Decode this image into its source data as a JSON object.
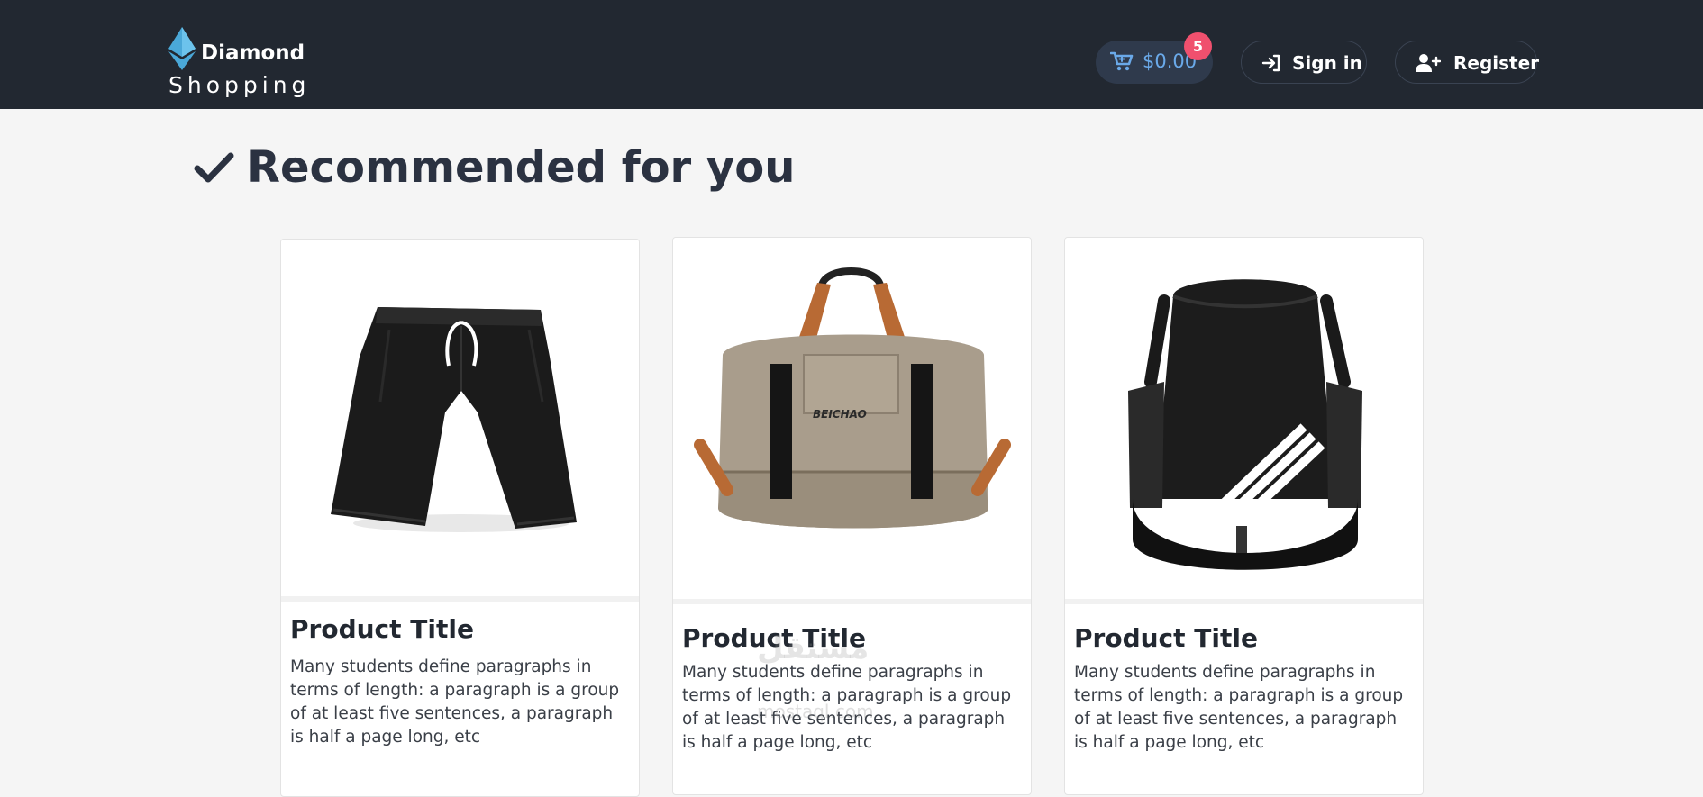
{
  "header": {
    "brand_line1": "Diamond",
    "brand_line2": "Shopping",
    "cart_amount": "$0.00",
    "cart_badge": "5",
    "signin_label": "Sign in",
    "register_label": "Register"
  },
  "section": {
    "title": "Recommended for you"
  },
  "products": [
    {
      "title": "Product Title",
      "description": "Many students define paragraphs in terms of length: a paragraph is a group of at least five sentences, a paragraph is half a page long, etc",
      "image_icon": "black-shorts"
    },
    {
      "title": "Product Title",
      "description": "Many students define paragraphs in terms of length: a paragraph is a group of at least five sentences, a paragraph is half a page long, etc",
      "image_icon": "duffel-bag"
    },
    {
      "title": "Product Title",
      "description": "Many students define paragraphs in terms of length: a paragraph is a group of at least five sentences, a paragraph is half a page long, etc",
      "image_icon": "drawstring-backpack"
    }
  ],
  "watermark": {
    "arabic": "مستقل",
    "latin": "mostaql.com"
  },
  "colors": {
    "header_bg": "#222831",
    "page_bg": "#f5f5f5",
    "accent_blue": "#6aa9e9",
    "badge_pink": "#f0506e",
    "gem_blue": "#4aa8d8"
  }
}
